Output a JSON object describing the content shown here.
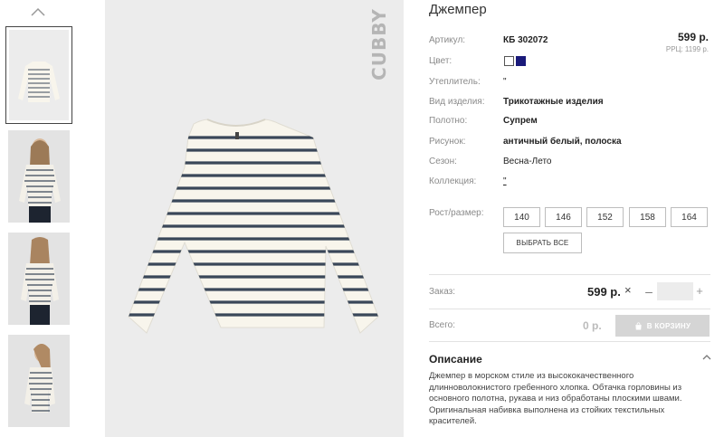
{
  "product": {
    "title": "Джемпер",
    "brand": "CUBBY",
    "price": "599 р.",
    "rrp": "РРЦ: 1199 р."
  },
  "attributes": {
    "article_label": "Артикул:",
    "article_value": "КБ 302072",
    "color_label": "Цвет:",
    "insulation_label": "Утеплитель:",
    "insulation_value": "\"",
    "type_label": "Вид изделия:",
    "type_value": "Трикотажные изделия",
    "fabric_label": "Полотно:",
    "fabric_value": "Супрем",
    "pattern_label": "Рисунок:",
    "pattern_value": "античный белый, полоска",
    "season_label": "Сезон:",
    "season_value": "Весна-Лето",
    "collection_label": "Коллекция:",
    "collection_value": "\""
  },
  "colors": {
    "swatch1": "#ffffff",
    "swatch2": "#1a1a7a",
    "stripe": "#3a4758",
    "body": "#f8f5ec"
  },
  "sizes": {
    "label": "Рост/размер:",
    "options": [
      "140",
      "146",
      "152",
      "158",
      "164"
    ],
    "select_all": "ВЫБРАТЬ ВСЕ"
  },
  "order": {
    "label": "Заказ:",
    "price": "599 р.",
    "remove_icon": "×",
    "minus": "–",
    "qty_value": "",
    "plus": "+"
  },
  "total": {
    "label": "Всего:",
    "value": "0 р.",
    "cart_button": "В КОРЗИНУ"
  },
  "description": {
    "title": "Описание",
    "text": "Джемпер в морском стиле из высококачественного длинноволокнистого гребенного хлопка. Обтачка горловины из основного полотна, рукава и низ обработаны плоскими швами. Оригинальная набивка выполнена из стойких текстильных красителей."
  }
}
